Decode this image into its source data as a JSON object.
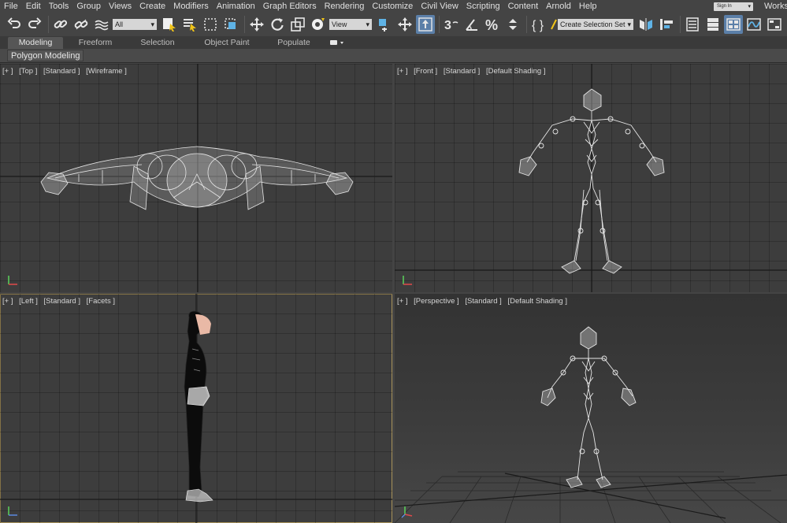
{
  "menubar": {
    "items": [
      "File",
      "Edit",
      "Tools",
      "Group",
      "Views",
      "Create",
      "Modifiers",
      "Animation",
      "Graph Editors",
      "Rendering",
      "Customize",
      "Civil View",
      "Scripting",
      "Content",
      "Arnold",
      "Help"
    ],
    "signin": "Sign In",
    "workspace": "Worksp"
  },
  "toolbar": {
    "selection_filter": "All",
    "ref_coord": "View",
    "named_selection": "Create Selection Set"
  },
  "ribbon": {
    "tabs": [
      "Modeling",
      "Freeform",
      "Selection",
      "Object Paint",
      "Populate"
    ],
    "active_tab": "Modeling",
    "panel_label": "Polygon Modeling"
  },
  "viewports": {
    "top": {
      "plus": "[+ ]",
      "view": "[Top ]",
      "mode": "[Standard ]",
      "shading": "[Wireframe ]"
    },
    "front": {
      "plus": "[+ ]",
      "view": "[Front ]",
      "mode": "[Standard ]",
      "shading": "[Default Shading ]"
    },
    "left": {
      "plus": "[+ ]",
      "view": "[Left ]",
      "mode": "[Standard ]",
      "shading": "[Facets ]"
    },
    "perspective": {
      "plus": "[+ ]",
      "view": "[Perspective ]",
      "mode": "[Standard ]",
      "shading": "[Default Shading ]"
    }
  },
  "colors": {
    "ui_bg": "#444444",
    "viewport_bg": "#3d3d3d",
    "active_border": "#a8925a",
    "highlight_blue": "#5b7fa8",
    "wire_white": "#e6e6e6"
  }
}
